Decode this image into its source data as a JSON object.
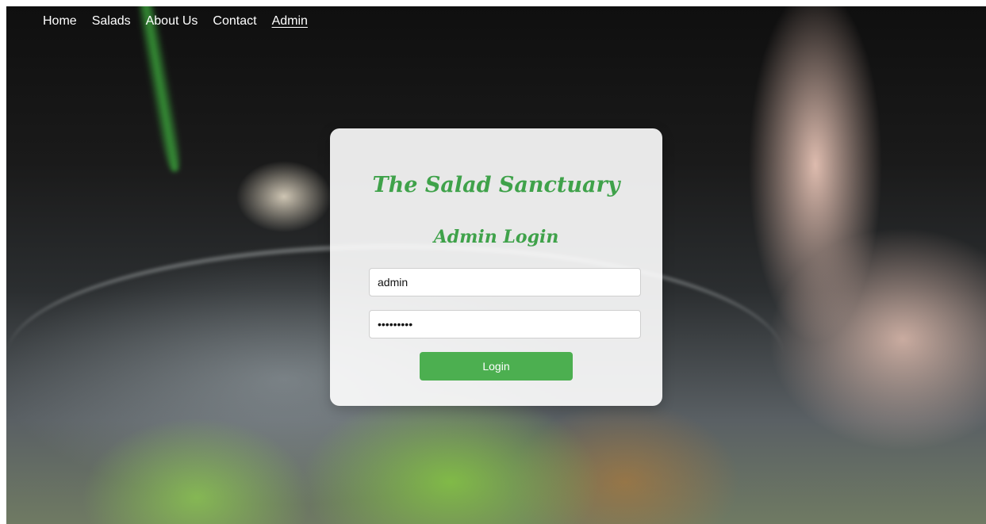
{
  "nav": {
    "items": [
      {
        "label": "Home"
      },
      {
        "label": "Salads"
      },
      {
        "label": "About Us"
      },
      {
        "label": "Contact"
      },
      {
        "label": "Admin",
        "active": true
      }
    ]
  },
  "login_card": {
    "brand": "The Salad Sanctuary",
    "title": "Admin Login",
    "username_value": "admin",
    "password_value": "password1",
    "button_label": "Login"
  },
  "colors": {
    "accent": "#3fa24a",
    "button": "#4caf50"
  }
}
